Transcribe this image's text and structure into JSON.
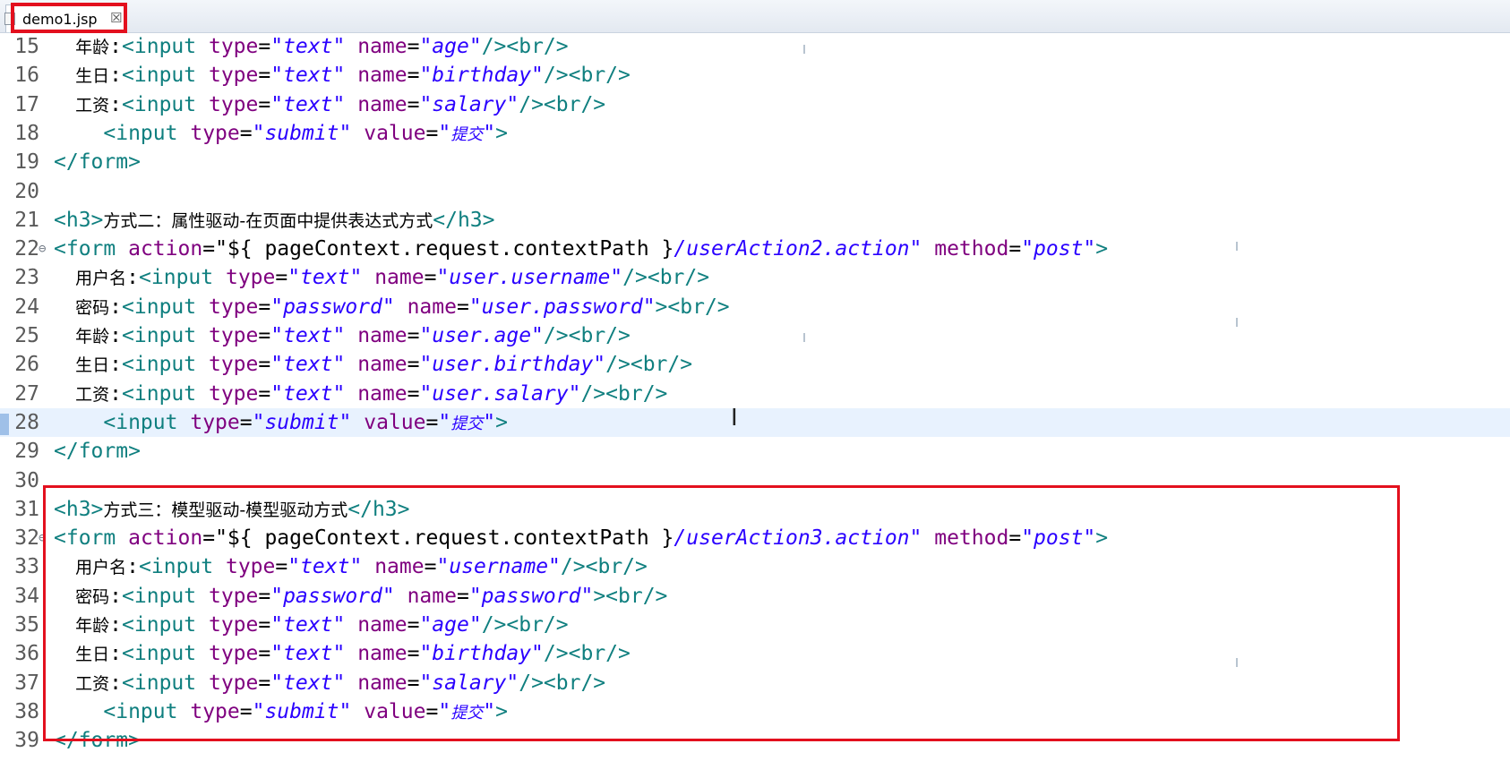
{
  "tab": {
    "title": "demo1.jsp",
    "close_glyph": "☒"
  },
  "icons": {
    "file": "jsp-file-icon",
    "close": "close-icon",
    "fold": "fold-collapse-icon"
  },
  "colors": {
    "highlight": "#e3101e",
    "current_line": "#e8f2fe"
  },
  "lines": [
    {
      "num": "15",
      "segs": [
        [
          "cn",
          "    年龄"
        ],
        [
          "tx",
          ":"
        ],
        [
          "tg",
          "<input"
        ],
        [
          "tx",
          " "
        ],
        [
          "at",
          "type"
        ],
        [
          "tx",
          "="
        ],
        [
          "st",
          "\"text\""
        ],
        [
          "tx",
          " "
        ],
        [
          "at",
          "name"
        ],
        [
          "tx",
          "="
        ],
        [
          "st",
          "\"age\""
        ],
        [
          "tg",
          "/>"
        ],
        [
          "tg",
          "<br/>"
        ]
      ]
    },
    {
      "num": "16",
      "segs": [
        [
          "cn",
          "    生日"
        ],
        [
          "tx",
          ":"
        ],
        [
          "tg",
          "<input"
        ],
        [
          "tx",
          " "
        ],
        [
          "at",
          "type"
        ],
        [
          "tx",
          "="
        ],
        [
          "st",
          "\"text\""
        ],
        [
          "tx",
          " "
        ],
        [
          "at",
          "name"
        ],
        [
          "tx",
          "="
        ],
        [
          "st",
          "\"birthday\""
        ],
        [
          "tg",
          "/>"
        ],
        [
          "tg",
          "<br/>"
        ]
      ]
    },
    {
      "num": "17",
      "segs": [
        [
          "cn",
          "    工资"
        ],
        [
          "tx",
          ":"
        ],
        [
          "tg",
          "<input"
        ],
        [
          "tx",
          " "
        ],
        [
          "at",
          "type"
        ],
        [
          "tx",
          "="
        ],
        [
          "st",
          "\"text\""
        ],
        [
          "tx",
          " "
        ],
        [
          "at",
          "name"
        ],
        [
          "tx",
          "="
        ],
        [
          "st",
          "\"salary\""
        ],
        [
          "tg",
          "/>"
        ],
        [
          "tg",
          "<br/>"
        ]
      ]
    },
    {
      "num": "18",
      "segs": [
        [
          "tx",
          "    "
        ],
        [
          "tg",
          "<input"
        ],
        [
          "tx",
          " "
        ],
        [
          "at",
          "type"
        ],
        [
          "tx",
          "="
        ],
        [
          "st",
          "\"submit\""
        ],
        [
          "tx",
          " "
        ],
        [
          "at",
          "value"
        ],
        [
          "tx",
          "="
        ],
        [
          "st",
          "\""
        ],
        [
          "cn-i",
          "提交"
        ],
        [
          "st",
          "\""
        ],
        [
          "tg",
          ">"
        ]
      ]
    },
    {
      "num": "19",
      "segs": [
        [
          "tg",
          "</form>"
        ]
      ]
    },
    {
      "num": "20",
      "segs": []
    },
    {
      "num": "21",
      "segs": [
        [
          "tg",
          "<h3>"
        ],
        [
          "cn",
          "方式二：属性驱动-在页面中提供表达式方式"
        ],
        [
          "tg",
          "</h3>"
        ]
      ]
    },
    {
      "num": "22",
      "fold": true,
      "segs": [
        [
          "tg",
          "<form"
        ],
        [
          "tx",
          " "
        ],
        [
          "at",
          "action"
        ],
        [
          "tx",
          "="
        ],
        [
          "tx",
          "\"${ pageContext.request.contextPath }"
        ],
        [
          "el",
          "/userAction2.action\""
        ],
        [
          "tx",
          " "
        ],
        [
          "at",
          "method"
        ],
        [
          "tx",
          "="
        ],
        [
          "st",
          "\"post\""
        ],
        [
          "tg",
          ">"
        ]
      ]
    },
    {
      "num": "23",
      "segs": [
        [
          "cn",
          "    用户名"
        ],
        [
          "tx",
          ":"
        ],
        [
          "tg",
          "<input"
        ],
        [
          "tx",
          " "
        ],
        [
          "at",
          "type"
        ],
        [
          "tx",
          "="
        ],
        [
          "st",
          "\"text\""
        ],
        [
          "tx",
          " "
        ],
        [
          "at",
          "name"
        ],
        [
          "tx",
          "="
        ],
        [
          "st",
          "\"user.username\""
        ],
        [
          "tg",
          "/>"
        ],
        [
          "tg",
          "<br/>"
        ]
      ]
    },
    {
      "num": "24",
      "segs": [
        [
          "cn",
          "    密码"
        ],
        [
          "tx",
          ":"
        ],
        [
          "tg",
          "<input"
        ],
        [
          "tx",
          " "
        ],
        [
          "at",
          "type"
        ],
        [
          "tx",
          "="
        ],
        [
          "st",
          "\"password\""
        ],
        [
          "tx",
          " "
        ],
        [
          "at",
          "name"
        ],
        [
          "tx",
          "="
        ],
        [
          "st",
          "\"user.password\""
        ],
        [
          "tg",
          ">"
        ],
        [
          "tg",
          "<br/>"
        ]
      ]
    },
    {
      "num": "25",
      "segs": [
        [
          "cn",
          "    年龄"
        ],
        [
          "tx",
          ":"
        ],
        [
          "tg",
          "<input"
        ],
        [
          "tx",
          " "
        ],
        [
          "at",
          "type"
        ],
        [
          "tx",
          "="
        ],
        [
          "st",
          "\"text\""
        ],
        [
          "tx",
          " "
        ],
        [
          "at",
          "name"
        ],
        [
          "tx",
          "="
        ],
        [
          "st",
          "\"user.age\""
        ],
        [
          "tg",
          "/>"
        ],
        [
          "tg",
          "<br/>"
        ]
      ]
    },
    {
      "num": "26",
      "segs": [
        [
          "cn",
          "    生日"
        ],
        [
          "tx",
          ":"
        ],
        [
          "tg",
          "<input"
        ],
        [
          "tx",
          " "
        ],
        [
          "at",
          "type"
        ],
        [
          "tx",
          "="
        ],
        [
          "st",
          "\"text\""
        ],
        [
          "tx",
          " "
        ],
        [
          "at",
          "name"
        ],
        [
          "tx",
          "="
        ],
        [
          "st",
          "\"user.birthday\""
        ],
        [
          "tg",
          "/>"
        ],
        [
          "tg",
          "<br/>"
        ]
      ]
    },
    {
      "num": "27",
      "segs": [
        [
          "cn",
          "    工资"
        ],
        [
          "tx",
          ":"
        ],
        [
          "tg",
          "<input"
        ],
        [
          "tx",
          " "
        ],
        [
          "at",
          "type"
        ],
        [
          "tx",
          "="
        ],
        [
          "st",
          "\"text\""
        ],
        [
          "tx",
          " "
        ],
        [
          "at",
          "name"
        ],
        [
          "tx",
          "="
        ],
        [
          "st",
          "\"user.salary\""
        ],
        [
          "tg",
          "/>"
        ],
        [
          "tg",
          "<br/>"
        ]
      ]
    },
    {
      "num": "28",
      "current": true,
      "segs": [
        [
          "tx",
          "    "
        ],
        [
          "tg",
          "<input"
        ],
        [
          "tx",
          " "
        ],
        [
          "at",
          "type"
        ],
        [
          "tx",
          "="
        ],
        [
          "st",
          "\"submit\""
        ],
        [
          "tx",
          " "
        ],
        [
          "at",
          "value"
        ],
        [
          "tx",
          "="
        ],
        [
          "st",
          "\""
        ],
        [
          "cn-i",
          "提交"
        ],
        [
          "st",
          "\""
        ],
        [
          "tg",
          ">"
        ]
      ]
    },
    {
      "num": "29",
      "segs": [
        [
          "tg",
          "</form>"
        ]
      ]
    },
    {
      "num": "30",
      "segs": []
    },
    {
      "num": "31",
      "segs": [
        [
          "tg",
          "<h3>"
        ],
        [
          "cn",
          "方式三：模型驱动-模型驱动方式"
        ],
        [
          "tg",
          "</h3>"
        ]
      ]
    },
    {
      "num": "32",
      "fold": true,
      "segs": [
        [
          "tg",
          "<form"
        ],
        [
          "tx",
          " "
        ],
        [
          "at",
          "action"
        ],
        [
          "tx",
          "="
        ],
        [
          "tx",
          "\"${ pageContext.request.contextPath }"
        ],
        [
          "el",
          "/userAction3.action\""
        ],
        [
          "tx",
          " "
        ],
        [
          "at",
          "method"
        ],
        [
          "tx",
          "="
        ],
        [
          "st",
          "\"post\""
        ],
        [
          "tg",
          ">"
        ]
      ]
    },
    {
      "num": "33",
      "segs": [
        [
          "cn",
          "    用户名"
        ],
        [
          "tx",
          ":"
        ],
        [
          "tg",
          "<input"
        ],
        [
          "tx",
          " "
        ],
        [
          "at",
          "type"
        ],
        [
          "tx",
          "="
        ],
        [
          "st",
          "\"text\""
        ],
        [
          "tx",
          " "
        ],
        [
          "at",
          "name"
        ],
        [
          "tx",
          "="
        ],
        [
          "st",
          "\"username\""
        ],
        [
          "tg",
          "/>"
        ],
        [
          "tg",
          "<br/>"
        ]
      ]
    },
    {
      "num": "34",
      "segs": [
        [
          "cn",
          "    密码"
        ],
        [
          "tx",
          ":"
        ],
        [
          "tg",
          "<input"
        ],
        [
          "tx",
          " "
        ],
        [
          "at",
          "type"
        ],
        [
          "tx",
          "="
        ],
        [
          "st",
          "\"password\""
        ],
        [
          "tx",
          " "
        ],
        [
          "at",
          "name"
        ],
        [
          "tx",
          "="
        ],
        [
          "st",
          "\"password\""
        ],
        [
          "tg",
          ">"
        ],
        [
          "tg",
          "<br/>"
        ]
      ]
    },
    {
      "num": "35",
      "segs": [
        [
          "cn",
          "    年龄"
        ],
        [
          "tx",
          ":"
        ],
        [
          "tg",
          "<input"
        ],
        [
          "tx",
          " "
        ],
        [
          "at",
          "type"
        ],
        [
          "tx",
          "="
        ],
        [
          "st",
          "\"text\""
        ],
        [
          "tx",
          " "
        ],
        [
          "at",
          "name"
        ],
        [
          "tx",
          "="
        ],
        [
          "st",
          "\"age\""
        ],
        [
          "tg",
          "/>"
        ],
        [
          "tg",
          "<br/>"
        ]
      ]
    },
    {
      "num": "36",
      "segs": [
        [
          "cn",
          "    生日"
        ],
        [
          "tx",
          ":"
        ],
        [
          "tg",
          "<input"
        ],
        [
          "tx",
          " "
        ],
        [
          "at",
          "type"
        ],
        [
          "tx",
          "="
        ],
        [
          "st",
          "\"text\""
        ],
        [
          "tx",
          " "
        ],
        [
          "at",
          "name"
        ],
        [
          "tx",
          "="
        ],
        [
          "st",
          "\"birthday\""
        ],
        [
          "tg",
          "/>"
        ],
        [
          "tg",
          "<br/>"
        ]
      ]
    },
    {
      "num": "37",
      "segs": [
        [
          "cn",
          "    工资"
        ],
        [
          "tx",
          ":"
        ],
        [
          "tg",
          "<input"
        ],
        [
          "tx",
          " "
        ],
        [
          "at",
          "type"
        ],
        [
          "tx",
          "="
        ],
        [
          "st",
          "\"text\""
        ],
        [
          "tx",
          " "
        ],
        [
          "at",
          "name"
        ],
        [
          "tx",
          "="
        ],
        [
          "st",
          "\"salary\""
        ],
        [
          "tg",
          "/>"
        ],
        [
          "tg",
          "<br/>"
        ]
      ]
    },
    {
      "num": "38",
      "segs": [
        [
          "tx",
          "    "
        ],
        [
          "tg",
          "<input"
        ],
        [
          "tx",
          " "
        ],
        [
          "at",
          "type"
        ],
        [
          "tx",
          "="
        ],
        [
          "st",
          "\"submit\""
        ],
        [
          "tx",
          " "
        ],
        [
          "at",
          "value"
        ],
        [
          "tx",
          "="
        ],
        [
          "st",
          "\""
        ],
        [
          "cn-i",
          "提交"
        ],
        [
          "st",
          "\""
        ],
        [
          "tg",
          ">"
        ]
      ]
    },
    {
      "num": "39",
      "segs": [
        [
          "tg",
          "</form>"
        ]
      ]
    }
  ]
}
